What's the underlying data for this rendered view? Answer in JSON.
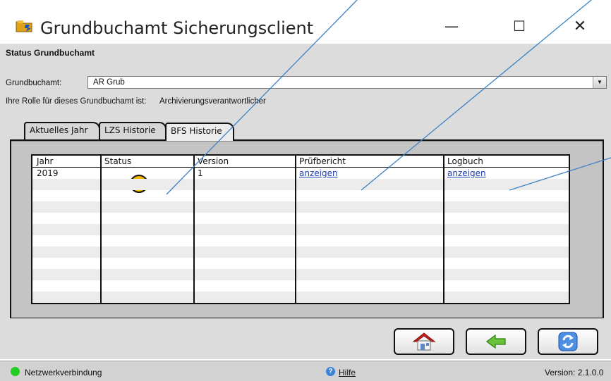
{
  "window": {
    "title": "Grundbuchamt Sicherungsclient",
    "minimize_glyph": "—",
    "maximize_glyph": "☐",
    "close_glyph": "✕"
  },
  "section": {
    "title": "Status Grundbuchamt"
  },
  "grundbuchamt": {
    "label": "Grundbuchamt:",
    "value": "AR Grub",
    "dropdown_glyph": "▼"
  },
  "rolle": {
    "label": "Ihre Rolle für dieses Grundbuchamt ist:",
    "value": "Archivierungsverantwortlicher"
  },
  "tabs": [
    {
      "label": "Aktuelles Jahr"
    },
    {
      "label": "LZS Historie"
    },
    {
      "label": "BFS Historie"
    }
  ],
  "active_tab": "BFS Historie",
  "table": {
    "headers": [
      "Jahr",
      "Status",
      "Version",
      "Prüfbericht",
      "Logbuch"
    ],
    "rows": [
      {
        "jahr": "2019",
        "status": "orange",
        "version": "1",
        "pruefbericht": "anzeigen",
        "logbuch": "anzeigen"
      }
    ]
  },
  "buttons": [
    {
      "name": "home-button",
      "icon": "home-icon"
    },
    {
      "name": "back-button",
      "icon": "arrow-left-icon"
    },
    {
      "name": "refresh-button",
      "icon": "refresh-icon"
    }
  ],
  "statusbar": {
    "connection": "Netzwerkverbindung",
    "connection_color": "#22cc22",
    "help": "Hilfe",
    "version": "Version: 2.1.0.0"
  },
  "colors": {
    "status_orange": "#f6b800",
    "link": "#1a3fb8",
    "annotation_line": "#3b82c4"
  }
}
